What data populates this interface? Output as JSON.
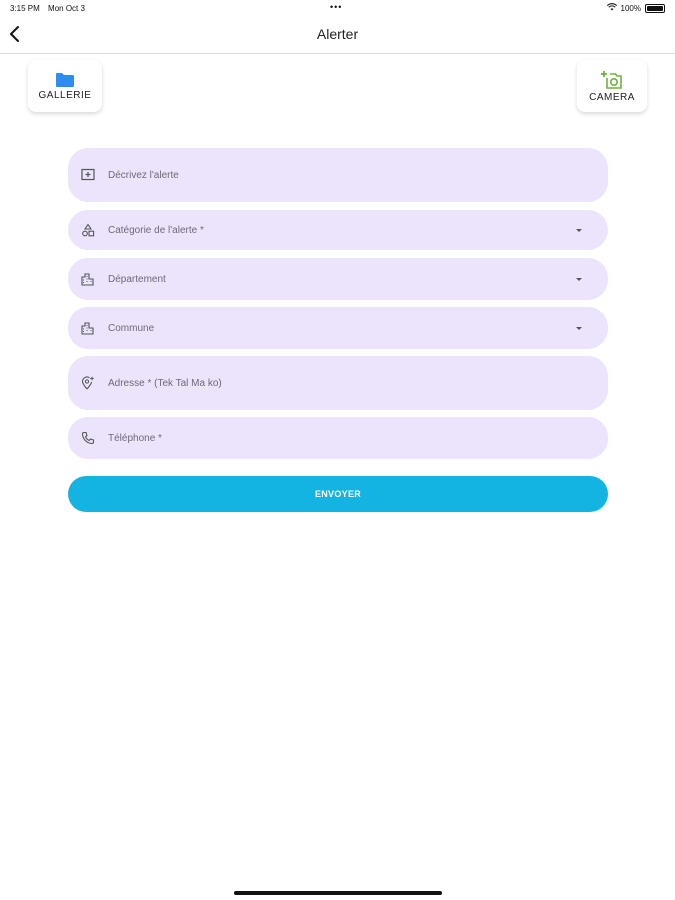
{
  "status_bar": {
    "time": "3:15 PM",
    "date": "Mon Oct 3",
    "dots": "•••",
    "battery_text": "100%",
    "wifi_icon": "wifi-icon",
    "battery_icon": "battery-icon"
  },
  "nav": {
    "title": "Alerter",
    "back_icon": "chevron-left-icon"
  },
  "media": {
    "gallery_label": "GALLERIE",
    "gallery_icon": "folder-icon",
    "camera_label": "CAMERA",
    "camera_icon": "add-photo-icon"
  },
  "form": {
    "description_placeholder": "Décrivez l'alerte",
    "category_placeholder": "Catégorie de l'alerte *",
    "department_placeholder": "Département",
    "commune_placeholder": "Commune",
    "address_placeholder": "Adresse * (Tek Tal Ma ko)",
    "phone_placeholder": "Téléphone *",
    "submit_label": "ENVOYER"
  },
  "colors": {
    "field_bg": "#ece3fd",
    "accent": "#14b4e2",
    "folder": "#2f8cf3",
    "camera": "#6ab43f"
  }
}
